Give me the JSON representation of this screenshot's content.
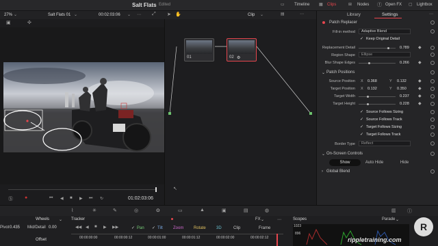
{
  "titlebar": {
    "project": "Salt Flats",
    "status": "Edited",
    "timeline": "Timeline",
    "clips": "Clips",
    "nodes": "Nodes",
    "openfx": "Open FX",
    "lightbox": "Lightbox"
  },
  "viewer": {
    "zoom": "27%",
    "clip_name": "Salt Flats 01",
    "timecode": "00:02:03:06",
    "source_timecode": "01:02:03:06"
  },
  "nodes": {
    "mode": "Clip",
    "items": [
      {
        "label": "01"
      },
      {
        "label": "02"
      }
    ]
  },
  "panel": {
    "tabs": [
      "Library",
      "Settings"
    ],
    "header": "Patch Replacer",
    "fill_method_label": "Fill-in method",
    "fill_method": "Adaptive Blend",
    "keep_original": "Keep Original Detail",
    "replacement_detail_label": "Replacement Detail",
    "replacement_detail": "0.789",
    "region_shape_label": "Region Shape",
    "region_shape": "Ellipse",
    "blur_shape_label": "Blur Shape Edges",
    "blur_shape": "0.266",
    "patch_positions": "Patch Positions",
    "source_position_label": "Source Position",
    "source_x": "0.368",
    "source_y": "0.132",
    "target_position_label": "Target Position",
    "target_x": "0.132",
    "target_y": "0.350",
    "target_width_label": "Target Width",
    "target_width": "0.237",
    "target_height_label": "Target Height",
    "target_height": "0.228",
    "source_follows_sizing": "Source Follows Sizing",
    "source_follows_track": "Source Follows Track",
    "target_follows_sizing": "Target Follows Sizing",
    "target_follows_track": "Target Follows Track",
    "border_type_label": "Border Type",
    "border_type": "Reflect",
    "onscreen_controls": "On-Screen Controls",
    "show": "Show",
    "auto_hide": "Auto Hide",
    "hide": "Hide",
    "global_blend": "Global Blend",
    "x_label": "X",
    "y_label": "Y"
  },
  "bottom": {
    "wheels": "Wheels",
    "pivot_label": "Pivot",
    "pivot": "0.435",
    "middetail_label": "Mid/Detail",
    "middetail": "0.00",
    "offset_label": "Offset",
    "tracker": "Tracker",
    "fx": "FX",
    "pan": "Pan",
    "tilt": "Tilt",
    "zoom": "Zoom",
    "rotate": "Rotate",
    "threed": "3D",
    "clip": "Clip",
    "frame": "Frame",
    "scopes": "Scopes",
    "parade": "Parade",
    "scope_1023": "1023",
    "scope_896": "896",
    "timecodes": [
      "00:00:00:00",
      "00:00:00:12",
      "00:00:01:00",
      "00:00:01:12",
      "00:00:02:00",
      "00:00:02:12"
    ],
    "watermark": "rippletraining.com"
  },
  "colors": {
    "accent": "#e8464e",
    "node_link": "#d8d84a",
    "check": "#e0e0e0"
  }
}
